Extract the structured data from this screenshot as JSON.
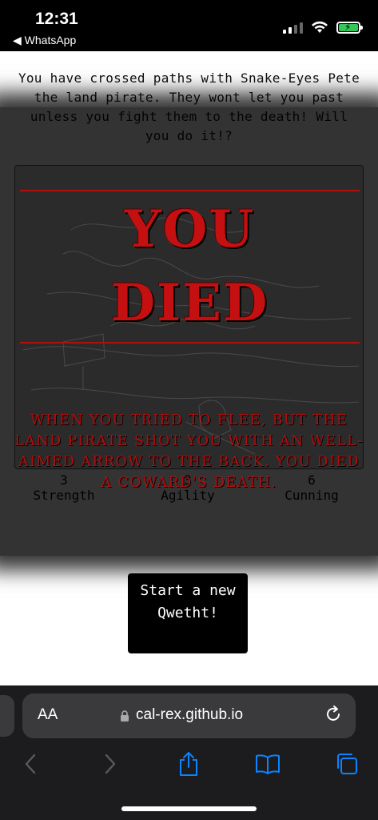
{
  "status_bar": {
    "time": "12:31",
    "back_app": "◀ WhatsApp",
    "battery_color": "#34c759"
  },
  "story": {
    "intro": "You have crossed paths with Snake-Eyes Pete the land pirate. They wont let you past unless you fight them to the death! Will you do it!?",
    "death_title_line1": "YOU",
    "death_title_line2": "DIED",
    "death_message": "WHEN YOU TRIED TO FLEE, BUT THE LAND PIRATE SHOT YOU WITH AN WELL-AIMED ARROW TO THE BACK. YOU DIED A COWARD'S DEATH.",
    "accent_color": "#c41010"
  },
  "stats": [
    {
      "value": "3",
      "label": "Strength"
    },
    {
      "value": "3",
      "label": "Agility"
    },
    {
      "value": "6",
      "label": "Cunning"
    }
  ],
  "start_button": {
    "label": "Start a new Qwetht!"
  },
  "safari": {
    "text_size_label": "AA",
    "url": "cal-rex.github.io"
  },
  "icons": [
    "wifi-icon",
    "signal-icon",
    "battery-icon",
    "lock-icon",
    "reload-icon",
    "back-icon",
    "forward-icon",
    "share-icon",
    "bookmarks-icon",
    "tabs-icon"
  ]
}
